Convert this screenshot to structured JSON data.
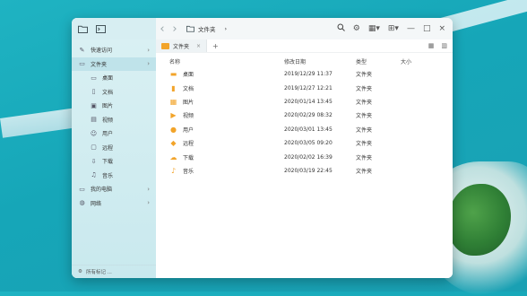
{
  "colors": {
    "accent": "#2b7be0",
    "folder": "#f2a42a",
    "sidebar_bg": "#d9f0f3",
    "selected": "#bfe3ea"
  },
  "titlebar": {
    "icons": [
      "folder-icon",
      "terminal-icon"
    ],
    "back_icon": "chevron-left-icon",
    "forward_icon": "chevron-right-icon",
    "address": {
      "icon": "folder-icon",
      "label": "文件夹",
      "arrow": "›"
    },
    "search_icon": "search-icon",
    "settings_icon": "gear-icon",
    "view_icon": "view-mode-icon",
    "sort_icon": "grid-icon",
    "window_buttons": [
      "minimize-icon",
      "maximize-icon",
      "close-icon"
    ]
  },
  "sidebar": {
    "items": [
      {
        "label": "快速访问",
        "icon": "pin-icon",
        "arrow": "›",
        "selected": false,
        "sub": false
      },
      {
        "label": "文件夹",
        "icon": "folder-icon",
        "arrow": "›",
        "selected": true,
        "sub": false
      },
      {
        "label": "桌面",
        "icon": "desktop-icon",
        "arrow": "",
        "selected": false,
        "sub": true
      },
      {
        "label": "文档",
        "icon": "document-icon",
        "arrow": "",
        "selected": false,
        "sub": true
      },
      {
        "label": "图片",
        "icon": "picture-icon",
        "arrow": "",
        "selected": false,
        "sub": true
      },
      {
        "label": "视频",
        "icon": "video-icon",
        "arrow": "",
        "selected": false,
        "sub": true
      },
      {
        "label": "用户",
        "icon": "user-icon",
        "arrow": "",
        "selected": false,
        "sub": true
      },
      {
        "label": "远程",
        "icon": "remote-icon",
        "arrow": "",
        "selected": false,
        "sub": true
      },
      {
        "label": "下载",
        "icon": "download-icon",
        "arrow": "",
        "selected": false,
        "sub": true
      },
      {
        "label": "音乐",
        "icon": "music-icon",
        "arrow": "",
        "selected": false,
        "sub": true
      },
      {
        "label": "我的电脑",
        "icon": "computer-icon",
        "arrow": "›",
        "selected": false,
        "sub": false
      },
      {
        "label": "网络",
        "icon": "network-icon",
        "arrow": "›",
        "selected": false,
        "sub": false
      }
    ],
    "bottom": {
      "icon": "gear-icon",
      "label": "所有标记 ..."
    }
  },
  "tabs": [
    {
      "label": "文件夹",
      "close": "×"
    }
  ],
  "tab_add": "+",
  "columns": {
    "name": "名称",
    "date": "修改日期",
    "type": "类型",
    "size": "大小"
  },
  "files": [
    {
      "name": "桌面",
      "date": "2019/12/29 11:37",
      "type": "文件夹",
      "icon": "desktop-folder-icon"
    },
    {
      "name": "文档",
      "date": "2019/12/27 12:21",
      "type": "文件夹",
      "icon": "document-folder-icon"
    },
    {
      "name": "图片",
      "date": "2020/01/14 13:45",
      "type": "文件夹",
      "icon": "picture-folder-icon"
    },
    {
      "name": "视频",
      "date": "2020/02/29 08:32",
      "type": "文件夹",
      "icon": "video-folder-icon"
    },
    {
      "name": "用户",
      "date": "2020/03/01 13:45",
      "type": "文件夹",
      "icon": "user-folder-icon"
    },
    {
      "name": "远程",
      "date": "2020/03/05 09:20",
      "type": "文件夹",
      "icon": "remote-folder-icon"
    },
    {
      "name": "下载",
      "date": "2020/02/02 16:39",
      "type": "文件夹",
      "icon": "download-folder-icon"
    },
    {
      "name": "音乐",
      "date": "2020/03/19 22:45",
      "type": "文件夹",
      "icon": "music-folder-icon"
    }
  ],
  "zoom_slider": {
    "value": 0.0
  }
}
